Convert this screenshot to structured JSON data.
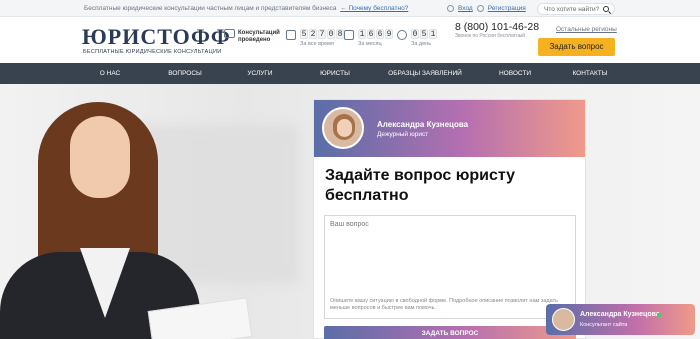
{
  "topbar": {
    "info": "Бесплатные юридические консультации частным лицам и представителям бизнеса",
    "why_free": "Почему бесплатно?",
    "login": "Вход",
    "register": "Регистрация",
    "search_placeholder": "Что хотите найти?"
  },
  "header": {
    "logo": "ЮРИСТОФФ",
    "logo_sub": "БЕСПЛАТНЫЕ ЮРИДИЧЕСКИЕ КОНСУЛЬТАЦИИ",
    "consult_label_1": "Консультаций",
    "consult_label_2": "проведено",
    "stats": [
      {
        "digits": [
          "5",
          "2",
          "7",
          "0",
          "8"
        ],
        "caption": "За все время"
      },
      {
        "digits": [
          "1",
          "6",
          "6",
          "9"
        ],
        "caption": "За месяц"
      },
      {
        "digits": [
          "0",
          "5",
          "1"
        ],
        "caption": "За день"
      }
    ],
    "phone": "8 (800) 101-46-28",
    "phone_caption": "Звонок по России бесплатный",
    "regions": "Остальные регионы",
    "ask_button": "Задать вопрос"
  },
  "nav": [
    "О НАС",
    "ВОПРОСЫ",
    "УСЛУГИ",
    "ЮРИСТЫ",
    "ОБРАЗЦЫ ЗАЯВЛЕНИЙ",
    "НОВОСТИ",
    "КОНТАКТЫ"
  ],
  "form": {
    "lawyer_name": "Александра Кузнецова",
    "lawyer_role": "Дежурный юрист",
    "title": "Задайте вопрос юристу бесплатно",
    "placeholder": "Ваш вопрос",
    "hint": "Опишите вашу ситуацию в свободной форме. Подробное описание позволит нам задать меньше вопросов и быстрее вам помочь.",
    "submit": "ЗАДАТЬ ВОПРОС"
  },
  "chat": {
    "name": "Александра Кузнецова",
    "status": "Консультант сайта"
  },
  "colors": {
    "nav_bg": "#39424f",
    "accent_button": "#f5b120",
    "gradient_start": "#5a6ea8",
    "gradient_end": "#f09a8a"
  }
}
